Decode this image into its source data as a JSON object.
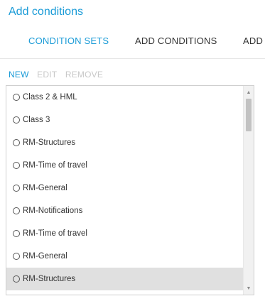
{
  "header": {
    "title": "Add conditions"
  },
  "tabs": [
    {
      "label": "CONDITION SETS",
      "active": true
    },
    {
      "label": "ADD CONDITIONS",
      "active": false
    },
    {
      "label": "ADD",
      "active": false
    }
  ],
  "actions": {
    "new_label": "NEW",
    "edit_label": "EDIT",
    "remove_label": "REMOVE"
  },
  "condition_sets": [
    {
      "label": "Class 2 & HML",
      "selected": false
    },
    {
      "label": "Class 3",
      "selected": false
    },
    {
      "label": "RM-Structures",
      "selected": false
    },
    {
      "label": "RM-Time of travel",
      "selected": false
    },
    {
      "label": "RM-General",
      "selected": false
    },
    {
      "label": "RM-Notifications",
      "selected": false
    },
    {
      "label": "RM-Time of travel",
      "selected": false
    },
    {
      "label": "RM-General",
      "selected": false
    },
    {
      "label": "RM-Structures",
      "selected": true
    }
  ],
  "colors": {
    "accent": "#1a9bd7",
    "disabled": "#c8c8c8",
    "selected_row": "#e0e0e0"
  }
}
